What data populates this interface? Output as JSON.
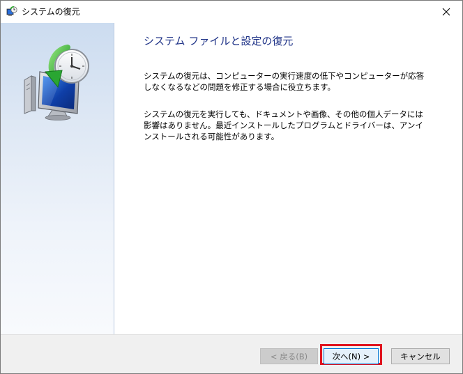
{
  "window": {
    "title": "システムの復元",
    "close_glyph": "✕"
  },
  "content": {
    "heading": "システム ファイルと設定の復元",
    "paragraph1": "システムの復元は、コンピューターの実行速度の低下やコンピューターが応答しなくなるなどの問題を修正する場合に役立ちます。",
    "paragraph2": "システムの復元を実行しても、ドキュメントや画像、その他の個人データには影響はありません。最近インストールしたプログラムとドライバーは、アンインストールされる可能性があります。"
  },
  "buttons": {
    "back_label": "< 戻る(B)",
    "next_label": "次へ(N) >",
    "cancel_label": "キャンセル"
  },
  "icons": {
    "title_icon": "system-restore-icon",
    "hero_icon": "system-restore-hero-icon",
    "close_icon": "close-icon"
  },
  "colors": {
    "heading": "#1e3287",
    "highlight": "#e0141e",
    "focus_border": "#0078d7"
  }
}
